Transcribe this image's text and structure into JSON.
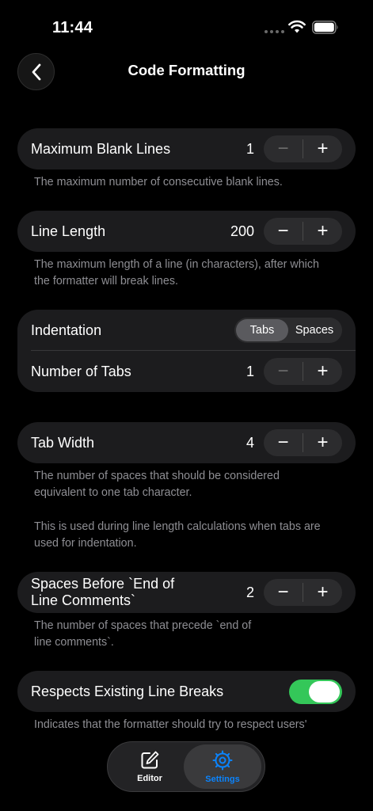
{
  "status_bar": {
    "time": "11:44"
  },
  "header": {
    "title": "Code Formatting"
  },
  "colors": {
    "accent": "#0a84ff",
    "toggle_on": "#34c759",
    "card_bg": "#1c1c1e",
    "secondary_text": "#8e8e93"
  },
  "settings": {
    "max_blank_lines": {
      "label": "Maximum Blank Lines",
      "value": "1",
      "decrement": "−",
      "increment": "+",
      "description": "The maximum number of consecutive blank lines."
    },
    "line_length": {
      "label": "Line Length",
      "value": "200",
      "decrement": "−",
      "increment": "+",
      "description_line1": "The maximum length of a line (in characters), after which",
      "description_line2": "the formatter will break lines."
    },
    "indentation": {
      "label": "Indentation",
      "options": [
        "Tabs",
        "Spaces"
      ],
      "selected": "Tabs"
    },
    "number_of_tabs": {
      "label": "Number of Tabs",
      "value": "1",
      "decrement": "−",
      "increment": "+"
    },
    "tab_width": {
      "label": "Tab Width",
      "value": "4",
      "decrement": "−",
      "increment": "+",
      "description_line1": "The number of spaces that should be considered",
      "description_line2": "equivalent to one tab character.",
      "description_line3": "This is used during line length calculations when tabs are",
      "description_line4": "used for indentation."
    },
    "spaces_before_end_of_line_comments": {
      "label_line1": "Spaces Before `End of",
      "label_line2": "Line Comments`",
      "value": "2",
      "decrement": "−",
      "increment": "+",
      "description_line1": "The number of spaces that precede `end of",
      "description_line2": "line comments`."
    },
    "respects_existing_line_breaks": {
      "label": "Respects Existing Line Breaks",
      "enabled": true,
      "description_line1": "Indicates that the formatter should try to respect users'"
    }
  },
  "tabbar": {
    "tabs": [
      {
        "label": "Editor",
        "icon": "edit-icon",
        "selected": false
      },
      {
        "label": "Settings",
        "icon": "gear-icon",
        "selected": true
      }
    ]
  }
}
